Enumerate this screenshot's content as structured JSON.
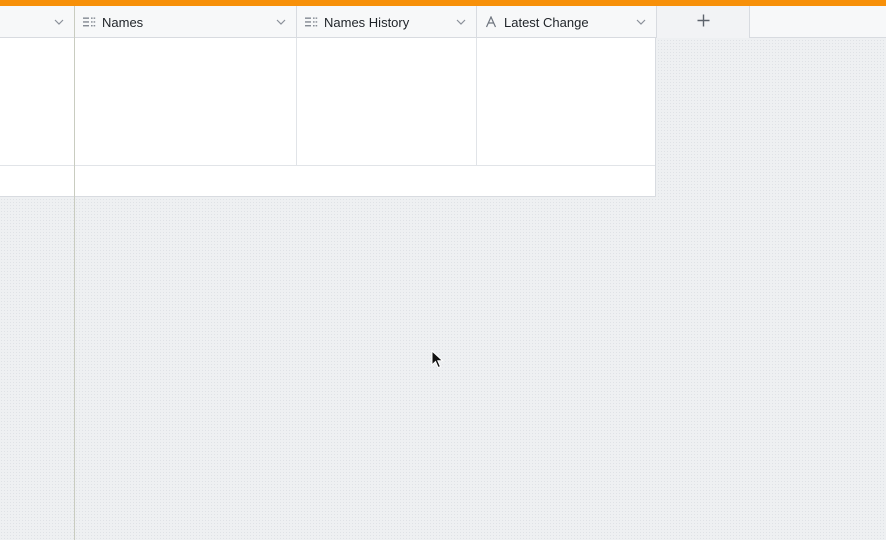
{
  "header": {
    "columns": [
      {
        "label": "",
        "icon": "chevron-down-icon"
      },
      {
        "label": "Names",
        "icon": "list-field-icon"
      },
      {
        "label": "Names History",
        "icon": "list-field-icon"
      },
      {
        "label": "Latest Change",
        "icon": "text-field-icon"
      }
    ],
    "add_column_icon": "plus-icon"
  },
  "colors": {
    "accent": "#f79009",
    "header_bg": "#f7f8f9",
    "border": "#d8dbe0",
    "canvas_bg": "#eef0f2"
  },
  "rows": [
    {
      "cells": [
        "",
        "",
        "",
        ""
      ]
    },
    {
      "cells": [
        "",
        "",
        "",
        ""
      ]
    }
  ]
}
